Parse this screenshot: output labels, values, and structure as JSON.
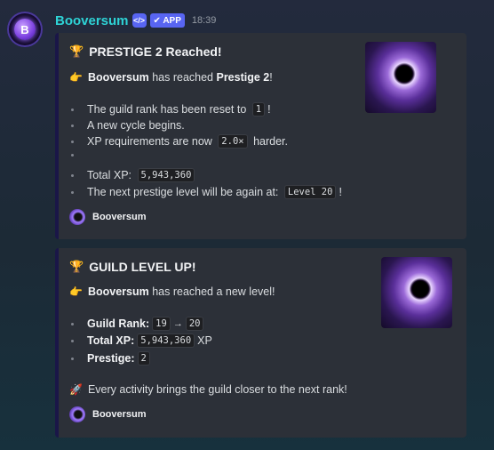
{
  "message": {
    "username": "Booversum",
    "dev_badge": "</>",
    "app_badge": "✔ APP",
    "time": "18:39"
  },
  "embeds": [
    {
      "title_icon": "🏆",
      "title": "PRESTIGE 2 Reached!",
      "intro_icon": "👉",
      "intro_user": "Booversum",
      "intro_mid": " has reached ",
      "intro_bold": "Prestige 2",
      "intro_end": "!",
      "lines": [
        {
          "pre": "The guild rank has been reset to ",
          "code": "1",
          "post": "!"
        },
        {
          "pre": "A new cycle begins.",
          "code": "",
          "post": ""
        },
        {
          "pre": "XP requirements are now ",
          "code": "2.0×",
          "post": " harder."
        },
        {
          "pre": "",
          "code": "",
          "post": ""
        },
        {
          "pre": "Total XP: ",
          "code": "5,943,360",
          "post": ""
        },
        {
          "pre": "The next prestige level will be again at: ",
          "code": "Level 20",
          "post": "!"
        }
      ],
      "footer": "Booversum"
    },
    {
      "title_icon": "🏆",
      "title": "GUILD LEVEL UP!",
      "intro_icon": "👉",
      "intro_user": "Booversum",
      "intro_mid": " has reached a new level!",
      "lines": [
        {
          "label": "Guild Rank:",
          "code1": "19",
          "arrow": "→",
          "code2": "20",
          "post": ""
        },
        {
          "label": "Total XP:",
          "code1": "5,943,360",
          "post": "XP"
        },
        {
          "label": "Prestige:",
          "code1": "2",
          "post": ""
        }
      ],
      "closing_icon": "🚀",
      "closing": "Every activity brings the guild closer to the next rank!",
      "footer": "Booversum"
    }
  ]
}
